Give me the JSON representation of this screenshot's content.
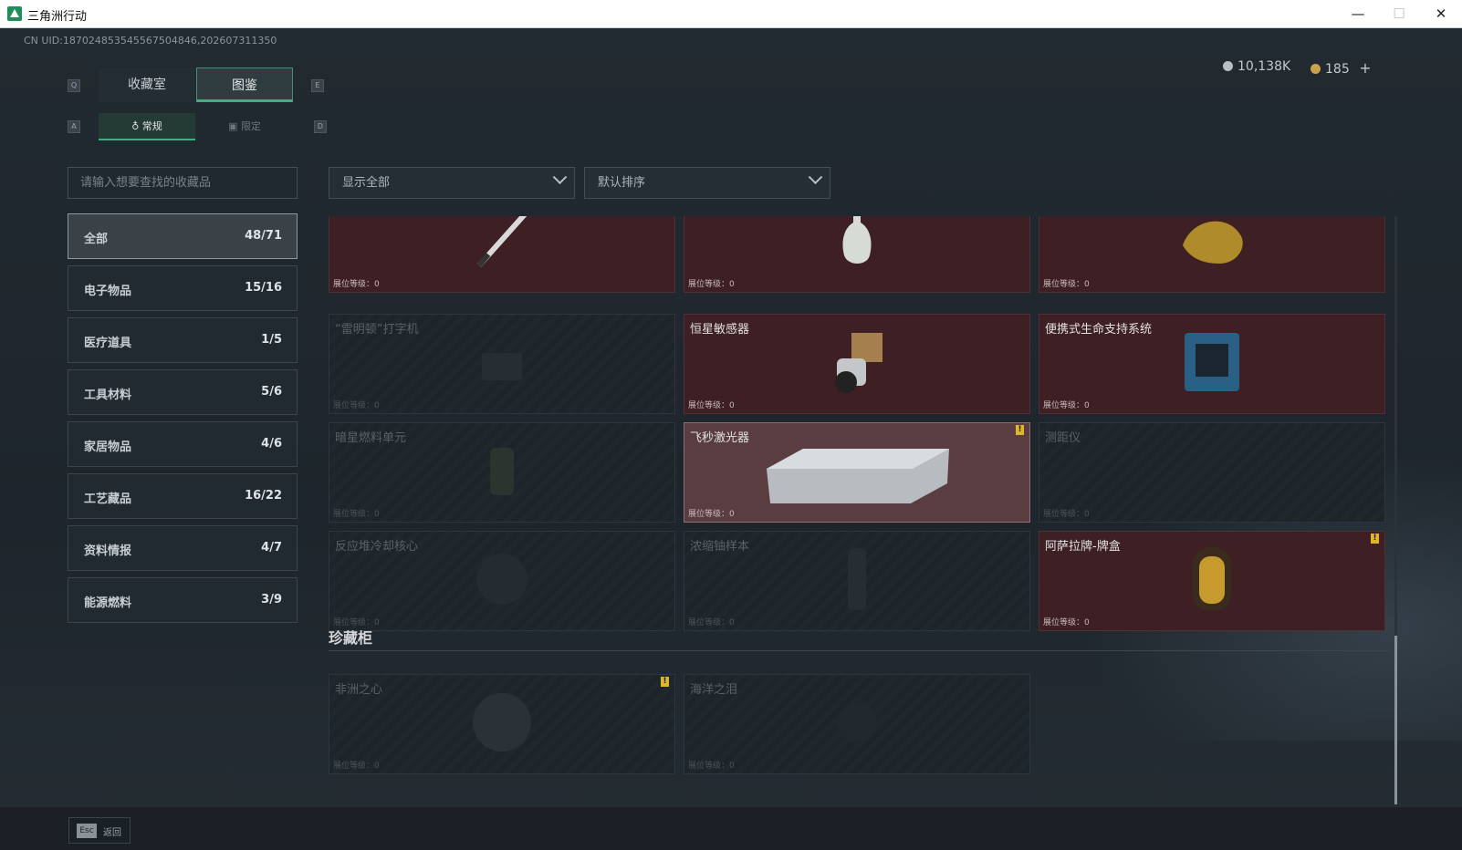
{
  "window": {
    "title": "三角洲行动",
    "minimize": "—",
    "maximize": "☐",
    "close": "✕"
  },
  "uid": "CN UID:187024853545567504846,202607311350",
  "currency": {
    "silver": "10,138K",
    "gold": "185",
    "add": "+"
  },
  "keys": {
    "q": "Q",
    "e": "E",
    "a": "A",
    "d": "D"
  },
  "tabs": [
    {
      "label": "收藏室"
    },
    {
      "label": "图鉴"
    }
  ],
  "subtabs": [
    {
      "label": "常规"
    },
    {
      "label": "限定"
    }
  ],
  "search": {
    "placeholder": "请输入想要查找的收藏品"
  },
  "filters": {
    "show": "显示全部",
    "sort": "默认排序"
  },
  "categories": [
    {
      "name": "全部",
      "count": "48/71"
    },
    {
      "name": "电子物品",
      "count": "15/16"
    },
    {
      "name": "医疗道具",
      "count": "1/5"
    },
    {
      "name": "工具材料",
      "count": "5/6"
    },
    {
      "name": "家居物品",
      "count": "4/6"
    },
    {
      "name": "工艺藏品",
      "count": "16/22"
    },
    {
      "name": "资料情报",
      "count": "4/7"
    },
    {
      "name": "能源燃料",
      "count": "3/9"
    }
  ],
  "items": [
    {
      "name": "",
      "level": "展位等级：0",
      "icon": "pen-icon"
    },
    {
      "name": "",
      "level": "展位等级：0",
      "icon": "vase-icon"
    },
    {
      "name": "",
      "level": "展位等级：0",
      "icon": "gold-dragon-icon"
    },
    {
      "name": "“雷明顿”打字机",
      "level": "展位等级：0",
      "icon": "typewriter-icon"
    },
    {
      "name": "恒星敏感器",
      "level": "展位等级：0",
      "icon": "star-sensor-icon"
    },
    {
      "name": "便携式生命支持系统",
      "level": "展位等级：0",
      "icon": "life-support-icon"
    },
    {
      "name": "暗星燃料单元",
      "level": "展位等级：0",
      "icon": "fuel-cell-icon"
    },
    {
      "name": "飞秒激光器",
      "level": "展位等级：0",
      "icon": "laser-icon",
      "badge": "!"
    },
    {
      "name": "测距仪",
      "level": "展位等级：0",
      "icon": "rangefinder-icon"
    },
    {
      "name": "反应堆冷却核心",
      "level": "展位等级：0",
      "icon": "reactor-core-icon"
    },
    {
      "name": "浓缩铀样本",
      "level": "展位等级：0",
      "icon": "uranium-icon"
    },
    {
      "name": "阿萨拉牌-牌盒",
      "level": "展位等级：0",
      "icon": "card-box-icon",
      "badge": "!"
    }
  ],
  "section": {
    "title": "珍藏柜"
  },
  "treasures": [
    {
      "name": "非洲之心",
      "level": "展位等级：0",
      "icon": "diamond-icon",
      "badge": "!"
    },
    {
      "name": "海洋之泪",
      "level": "展位等级：0",
      "icon": "pearl-icon"
    }
  ],
  "footer": {
    "key": "Esc",
    "label": "返回"
  }
}
